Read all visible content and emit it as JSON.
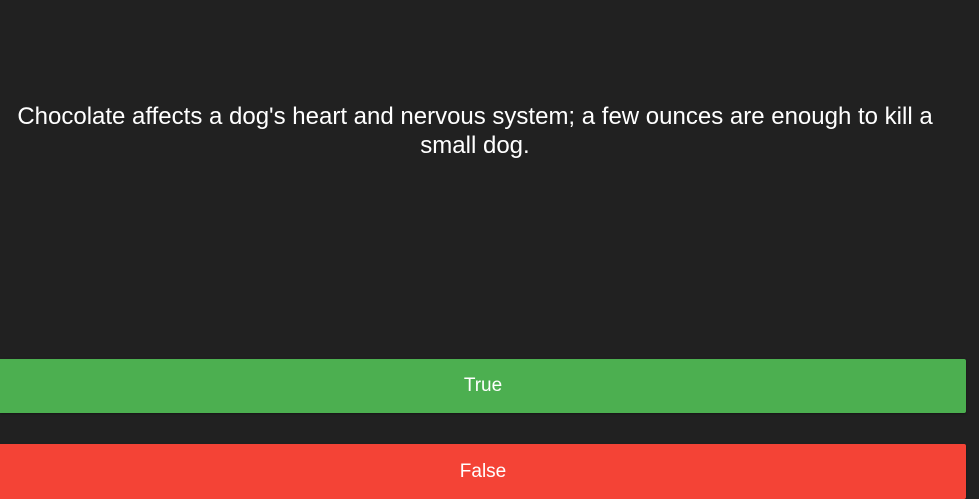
{
  "quiz": {
    "question": "Chocolate affects a dog's heart and nervous system; a few ounces are enough to kill a small dog.",
    "answers": [
      {
        "label": "True"
      },
      {
        "label": "False"
      }
    ]
  },
  "colors": {
    "background": "#212121",
    "true_button": "#4caf50",
    "false_button": "#f44336",
    "text": "#ffffff"
  }
}
